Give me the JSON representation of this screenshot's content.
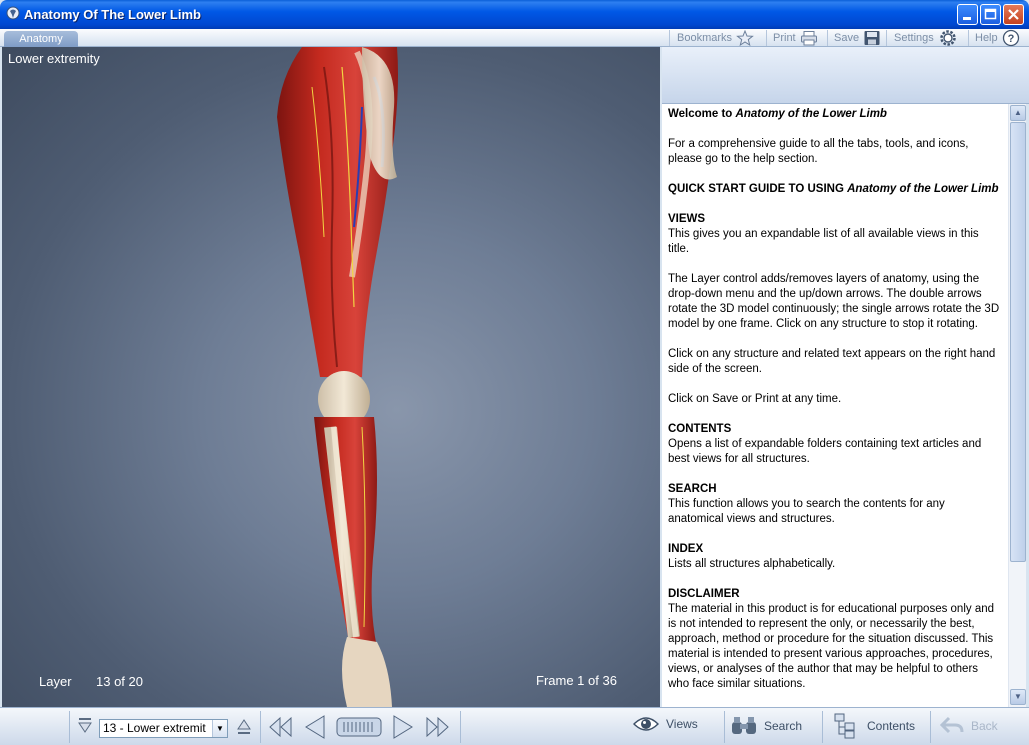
{
  "window": {
    "title": "Anatomy Of The Lower Limb"
  },
  "menubar": {
    "tab": "Anatomy",
    "bookmarks": "Bookmarks",
    "print": "Print",
    "save": "Save",
    "settings": "Settings",
    "help": "Help"
  },
  "viewer": {
    "view_title": "Lower extremity",
    "layer_label": "Layer",
    "layer_value": "13 of 20",
    "frame_label": "Frame 1 of 36"
  },
  "article": {
    "welcome_prefix": "Welcome to ",
    "welcome_title": "Anatomy of the Lower Limb",
    "intro": "For a comprehensive guide to all the tabs, tools, and icons, please go to the help section.",
    "quickstart_prefix": "QUICK START GUIDE TO USING ",
    "quickstart_title": "Anatomy of the Lower Limb",
    "views_heading": "VIEWS",
    "views_text": "This gives you an expandable list of all available views in this title.",
    "layer_text": "The Layer control adds/removes layers of anatomy, using the drop-down menu and the up/down arrows. The double arrows rotate the 3D model continuously; the single arrows rotate the 3D model by one frame. Click on any structure to stop it rotating.",
    "click_text": "Click on any structure and related text appears on the right hand side of the screen.",
    "save_text": "Click on Save or Print at any time.",
    "contents_heading": "CONTENTS",
    "contents_text": "Opens a list of expandable folders containing text articles and best views for all structures.",
    "search_heading": "SEARCH",
    "search_text": "This function allows you to search the contents for any anatomical views and structures.",
    "index_heading": "INDEX",
    "index_text": "Lists all structures alphabetically.",
    "disclaimer_heading": "DISCLAIMER",
    "disclaimer_text": "The material in this product is for educational purposes only and is not intended to represent the only, or necessarily the best, approach, method or procedure for the situation discussed. This material is intended to present various approaches, procedures, views, or analyses of the author that may be helpful to others who face similar situations."
  },
  "bottombar": {
    "layer_select": "13 - Lower extremit",
    "views": "Views",
    "search": "Search",
    "contents": "Contents",
    "back": "Back"
  }
}
